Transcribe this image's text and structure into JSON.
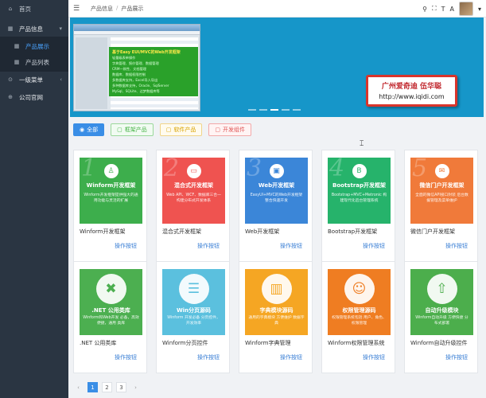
{
  "sidebar": {
    "items": [
      {
        "icon": "home-icon",
        "glyph": "⌂",
        "label": "首页",
        "kind": "top"
      },
      {
        "icon": "grid-icon",
        "glyph": "▦",
        "label": "产品信息",
        "kind": "parent",
        "caret": "v"
      },
      {
        "icon": "grid-small-icon",
        "glyph": "▦",
        "label": "产品展示",
        "kind": "sub active"
      },
      {
        "icon": "grid-small-icon",
        "glyph": "▦",
        "label": "产品列表",
        "kind": "sub"
      },
      {
        "icon": "circle-icon",
        "glyph": "⊙",
        "label": "一级菜单",
        "kind": "parent",
        "caret": "<"
      },
      {
        "icon": "globe-icon",
        "glyph": "⊕",
        "label": "公司官网",
        "kind": "parent"
      }
    ]
  },
  "topbar": {
    "breadcrumb": [
      "产品信息",
      "产品展示"
    ],
    "separator": "/"
  },
  "banner": {
    "green_title": "基于Easy EUI/MVC的Web开发框架",
    "green_lines": [
      "轻量级表单操作",
      "字典管理、报价管理、数据管理",
      "CRM一致性、文档管理",
      "数据库、数据权限控制",
      "多数据库支持，Excel导入导出",
      "多种数据库支持，Oracle、SqlServer",
      "MySql、SQLite、达梦数据库等"
    ],
    "watermark_name": "广州爱奇迪 伍华聪",
    "watermark_url": "http://www.iqidi.com"
  },
  "filters": [
    {
      "label": "全部",
      "cls": "all",
      "glyph": "◉"
    },
    {
      "label": "框架产品",
      "cls": "g",
      "glyph": "▢"
    },
    {
      "label": "软件产品",
      "cls": "y",
      "glyph": "▢"
    },
    {
      "label": "开发组件",
      "cls": "r",
      "glyph": "▢"
    }
  ],
  "action_label": "操作按钮",
  "cards": [
    {
      "name": "Winform开发框架",
      "title": "Winform开发框架",
      "num": "1",
      "color": "#3dae4c",
      "icon": "person-icon",
      "glyph": "♙",
      "desc": "Winform开发框架提供强大的通用功能与灵活的扩展"
    },
    {
      "name": "混合式开发框架",
      "title": "混合式开发框架",
      "num": "2",
      "color": "#ef5350",
      "icon": "monitor-icon",
      "glyph": "▭",
      "desc": "Web API、WCF、数据库三合一 构建分布式开发体系"
    },
    {
      "name": "Web开发框架",
      "title": "Web开发框架",
      "num": "3",
      "color": "#3b86d8",
      "icon": "screen-icon",
      "glyph": "▣",
      "desc": "EasyUI+MVC的Web开发框架 整合快速开发"
    },
    {
      "name": "Bootstrap开发框架",
      "title": "Bootstrap开发框架",
      "num": "4",
      "color": "#26b36b",
      "icon": "bootstrap-icon",
      "glyph": "B",
      "desc": "Bootstrap+MVC+Metronic 构建现代化后台管理系统"
    },
    {
      "name": "微信门户开发框架",
      "title": "微信门户开发框架",
      "num": "5",
      "color": "#f07a3a",
      "icon": "wechat-icon",
      "glyph": "✉",
      "desc": "全面的微信API接口封装 后台数据管理及菜单维护"
    },
    {
      "name": ".NET 公用类库",
      "title": ".NET 公用类库",
      "num": "",
      "color": "#4caf50",
      "icon": "tools-icon",
      "glyph": "✖",
      "desc": "Winform和Web开发 必备，高效便捷，通用 类库"
    },
    {
      "name": "Winform分页控件",
      "title": "Win分页源码",
      "num": "",
      "color": "#5bc0de",
      "icon": "pager-icon",
      "glyph": "☰",
      "desc": "Winform 开发必备 分页控件，开发效率"
    },
    {
      "name": "Winform字典管理",
      "title": "字典模块源码",
      "num": "",
      "color": "#f5a623",
      "icon": "books-icon",
      "glyph": "▥",
      "desc": "通用的字典模块 方便维护 数据字典"
    },
    {
      "name": "Winform权限管理系统",
      "title": "权限管理源码",
      "num": "",
      "color": "#ef7d22",
      "icon": "users-icon",
      "glyph": "☺",
      "desc": "权限管理系统包括 用户、角色、权限管理"
    },
    {
      "name": "Winform自动升级控件",
      "title": "自动升级模块",
      "num": "",
      "color": "#4cae4c",
      "icon": "upgrade-icon",
      "glyph": "⇧",
      "desc": "Winform自动升级 方便快捷 分布式部署"
    }
  ],
  "pager": {
    "prev": "‹",
    "pages": [
      "1",
      "2",
      "3"
    ],
    "current": "1",
    "next": "›"
  },
  "colors": {
    "sidebar_bg": "#2a3542",
    "accent": "#3a8ee6",
    "banner_bg": "#1696c9"
  }
}
